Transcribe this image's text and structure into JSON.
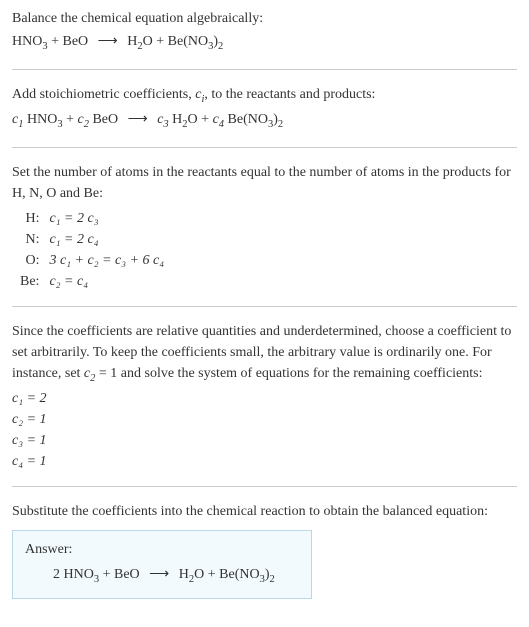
{
  "s1": {
    "title": "Balance the chemical equation algebraically:",
    "lhs1": "HNO",
    "lhs1sub": "3",
    "plus": " + ",
    "lhs2": "BeO",
    "arrow": "⟶",
    "rhs1": "H",
    "rhs1sub": "2",
    "rhs1b": "O",
    "rhs2": "Be(NO",
    "rhs2sub": "3",
    "rhs2b": ")",
    "rhs2sub2": "2"
  },
  "s2": {
    "title1": "Add stoichiometric coefficients, ",
    "ci": "c",
    "ci_sub": "i",
    "title2": ", to the reactants and products:",
    "c1": "c",
    "c1sub": "1",
    "sp1": " HNO",
    "sp1sub": "3",
    "c2": "c",
    "c2sub": "2",
    "sp2": " BeO",
    "c3": "c",
    "c3sub": "3",
    "sp3a": " H",
    "sp3sub": "2",
    "sp3b": "O",
    "c4": "c",
    "c4sub": "4",
    "sp4a": " Be(NO",
    "sp4sub": "3",
    "sp4b": ")",
    "sp4sub2": "2"
  },
  "s3": {
    "title": "Set the number of atoms in the reactants equal to the number of atoms in the products for H, N, O and Be:",
    "rows": [
      {
        "el": "H:",
        "lhs": "c₁ = 2 c₃"
      },
      {
        "el": "N:",
        "lhs": "c₁ = 2 c₄"
      },
      {
        "el": "O:",
        "lhs": "3 c₁ + c₂ = c₃ + 6 c₄"
      },
      {
        "el": "Be:",
        "lhs": "c₂ = c₄"
      }
    ]
  },
  "s4": {
    "para1": "Since the coefficients are relative quantities and underdetermined, choose a coefficient to set arbitrarily. To keep the coefficients small, the arbitrary value is ordinarily one. For instance, set ",
    "cvar": "c",
    "cvarsub": "2",
    "para2": " = 1 and solve the system of equations for the remaining coefficients:",
    "lines": [
      "c₁ = 2",
      "c₂ = 1",
      "c₃ = 1",
      "c₄ = 1"
    ]
  },
  "s5": {
    "para": "Substitute the coefficients into the chemical reaction to obtain the balanced equation:",
    "answer_label": "Answer:",
    "two": "2 ",
    "lhs1": "HNO",
    "lhs1sub": "3",
    "lhs2": "BeO",
    "rhs1": "H",
    "rhs1sub": "2",
    "rhs1b": "O",
    "rhs2": "Be(NO",
    "rhs2sub": "3",
    "rhs2b": ")",
    "rhs2sub2": "2"
  },
  "sym": {
    "plus": " + ",
    "arrow": "⟶"
  }
}
